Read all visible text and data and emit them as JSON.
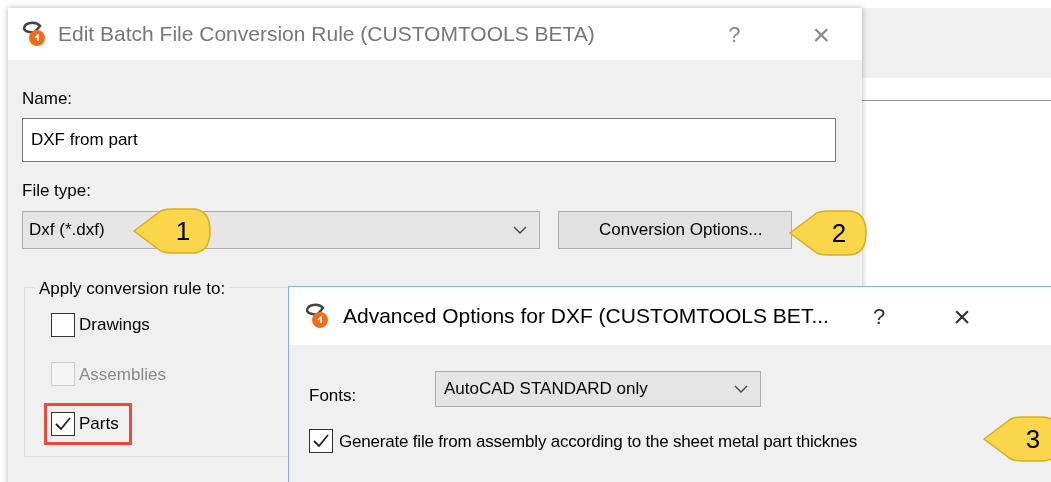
{
  "main_dialog": {
    "title": "Edit Batch File Conversion Rule (CUSTOMTOOLS BETA)",
    "help": "?",
    "close": "×",
    "name_label": "Name:",
    "name_value": "DXF from part",
    "file_type_label": "File type:",
    "file_type_value": "Dxf (*.dxf)",
    "file_type_callout": "1",
    "conversion_button": "Conversion Options...",
    "conversion_callout": "2",
    "group_label": "Apply conversion rule to:",
    "checkboxes": [
      {
        "label": "Drawings",
        "checked": false,
        "disabled": false,
        "highlighted": false
      },
      {
        "label": "Assemblies",
        "checked": false,
        "disabled": true,
        "highlighted": false
      },
      {
        "label": "Parts",
        "checked": true,
        "disabled": false,
        "highlighted": true
      }
    ]
  },
  "advanced_dialog": {
    "title": "Advanced Options for DXF (CUSTOMTOOLS BET...",
    "help": "?",
    "close": "×",
    "fonts_label": "Fonts:",
    "fonts_value": "AutoCAD STANDARD only",
    "generate": {
      "label": "Generate file from assembly according to the sheet metal part thicknes",
      "checked": true
    },
    "generate_callout": "3"
  }
}
